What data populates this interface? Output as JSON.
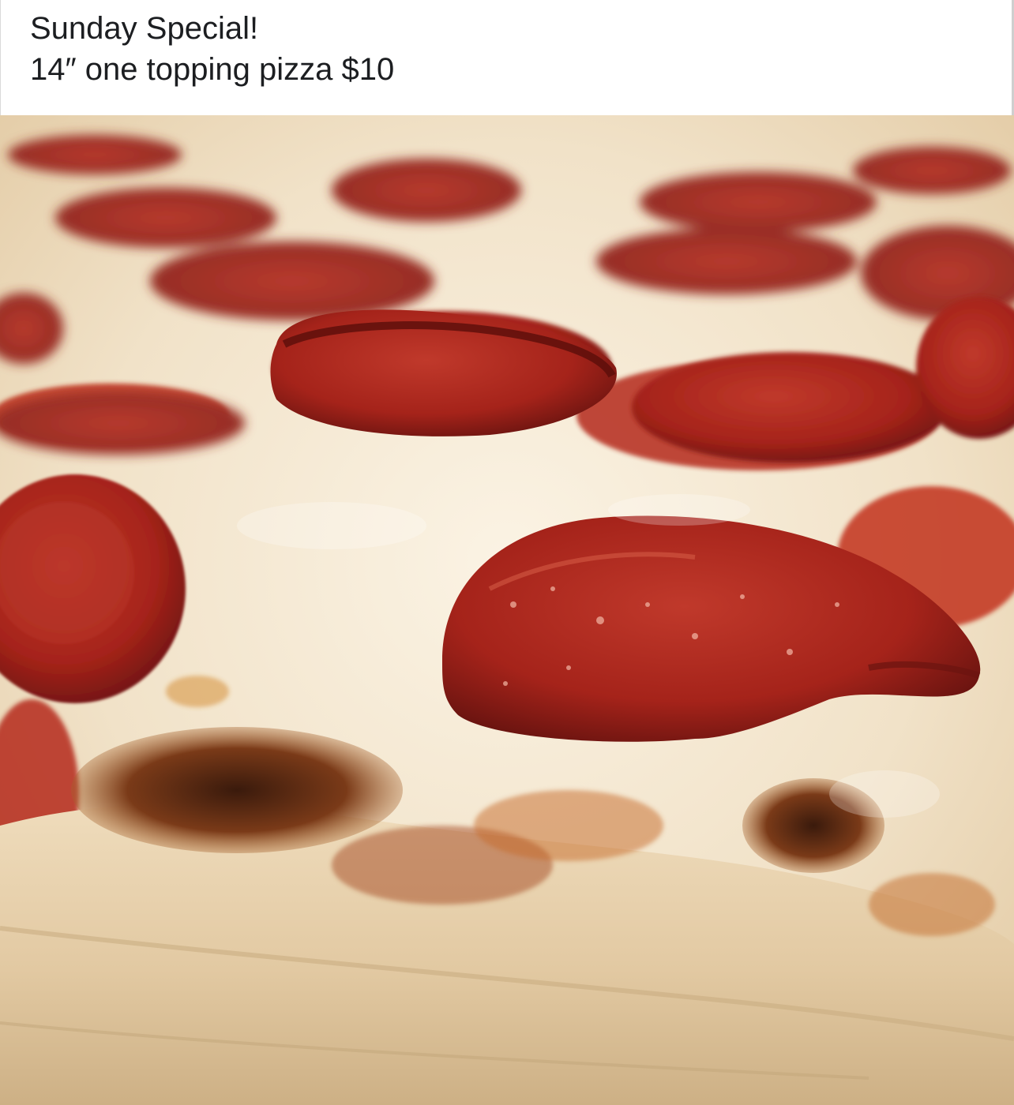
{
  "post": {
    "caption_line1": "Sunday Special!",
    "caption_line2": "14″ one topping pizza $10"
  },
  "photo": {
    "subject": "pepperoni-pizza",
    "colors": {
      "cheese": "#f3e7d2",
      "pepperoni": "#a8231a",
      "pepperoni_dark": "#6e1410",
      "crust": "#e6d2b2",
      "char": "#4a2413",
      "sauce": "#c2321f"
    }
  }
}
